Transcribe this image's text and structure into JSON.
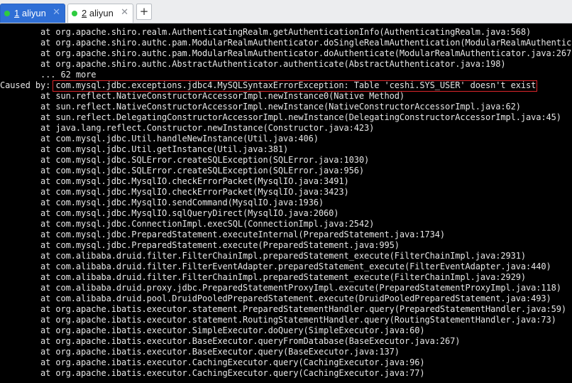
{
  "tabs": [
    {
      "number": "1",
      "name": " aliyun",
      "status_color": "#2ecc40",
      "active": true
    },
    {
      "number": "2",
      "name": " aliyun",
      "status_color": "#2ecc40",
      "active": false
    }
  ],
  "tab_close_glyph": "✕",
  "new_tab_glyph": "+",
  "highlight_color": "#e0262b",
  "terminal": {
    "lines": [
      "        at org.apache.shiro.realm.AuthenticatingRealm.getAuthenticationInfo(AuthenticatingRealm.java:568)",
      "        at org.apache.shiro.authc.pam.ModularRealmAuthenticator.doSingleRealmAuthentication(ModularRealmAuthenticat",
      "        at org.apache.shiro.authc.pam.ModularRealmAuthenticator.doAuthenticate(ModularRealmAuthenticator.java:267)",
      "        at org.apache.shiro.authc.AbstractAuthenticator.authenticate(AbstractAuthenticator.java:198)",
      "        ... 62 more",
      "Caused by: com.mysql.jdbc.exceptions.jdbc4.MySQLSyntaxErrorException: Table 'ceshi.SYS_USER' doesn't exist",
      "        at sun.reflect.NativeConstructorAccessorImpl.newInstance0(Native Method)",
      "        at sun.reflect.NativeConstructorAccessorImpl.newInstance(NativeConstructorAccessorImpl.java:62)",
      "        at sun.reflect.DelegatingConstructorAccessorImpl.newInstance(DelegatingConstructorAccessorImpl.java:45)",
      "        at java.lang.reflect.Constructor.newInstance(Constructor.java:423)",
      "        at com.mysql.jdbc.Util.handleNewInstance(Util.java:406)",
      "        at com.mysql.jdbc.Util.getInstance(Util.java:381)",
      "        at com.mysql.jdbc.SQLError.createSQLException(SQLError.java:1030)",
      "        at com.mysql.jdbc.SQLError.createSQLException(SQLError.java:956)",
      "        at com.mysql.jdbc.MysqlIO.checkErrorPacket(MysqlIO.java:3491)",
      "        at com.mysql.jdbc.MysqlIO.checkErrorPacket(MysqlIO.java:3423)",
      "        at com.mysql.jdbc.MysqlIO.sendCommand(MysqlIO.java:1936)",
      "        at com.mysql.jdbc.MysqlIO.sqlQueryDirect(MysqlIO.java:2060)",
      "        at com.mysql.jdbc.ConnectionImpl.execSQL(ConnectionImpl.java:2542)",
      "        at com.mysql.jdbc.PreparedStatement.executeInternal(PreparedStatement.java:1734)",
      "        at com.mysql.jdbc.PreparedStatement.execute(PreparedStatement.java:995)",
      "        at com.alibaba.druid.filter.FilterChainImpl.preparedStatement_execute(FilterChainImpl.java:2931)",
      "        at com.alibaba.druid.filter.FilterEventAdapter.preparedStatement_execute(FilterEventAdapter.java:440)",
      "        at com.alibaba.druid.filter.FilterChainImpl.preparedStatement_execute(FilterChainImpl.java:2929)",
      "        at com.alibaba.druid.proxy.jdbc.PreparedStatementProxyImpl.execute(PreparedStatementProxyImpl.java:118)",
      "        at com.alibaba.druid.pool.DruidPooledPreparedStatement.execute(DruidPooledPreparedStatement.java:493)",
      "        at org.apache.ibatis.executor.statement.PreparedStatementHandler.query(PreparedStatementHandler.java:59)",
      "        at org.apache.ibatis.executor.statement.RoutingStatementHandler.query(RoutingStatementHandler.java:73)",
      "        at org.apache.ibatis.executor.SimpleExecutor.doQuery(SimpleExecutor.java:60)",
      "        at org.apache.ibatis.executor.BaseExecutor.queryFromDatabase(BaseExecutor.java:267)",
      "        at org.apache.ibatis.executor.BaseExecutor.query(BaseExecutor.java:137)",
      "        at org.apache.ibatis.executor.CachingExecutor.query(CachingExecutor.java:96)",
      "        at org.apache.ibatis.executor.CachingExecutor.query(CachingExecutor.java:77)"
    ]
  }
}
